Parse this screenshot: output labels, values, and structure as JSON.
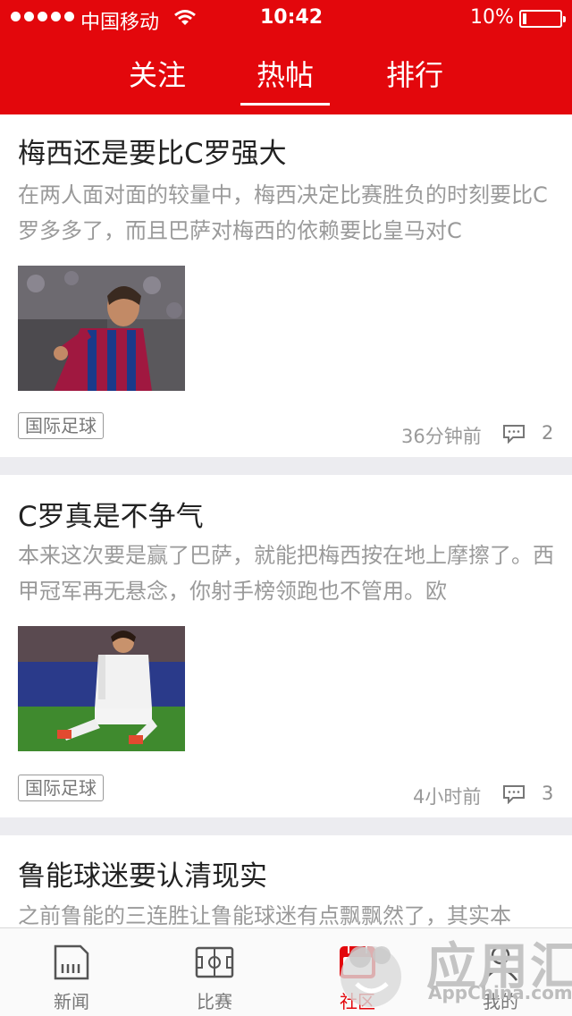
{
  "status_bar": {
    "carrier": "中国移动",
    "time": "10:42",
    "battery": "10%"
  },
  "tabs": [
    {
      "label": "关注",
      "active": false
    },
    {
      "label": "热帖",
      "active": true
    },
    {
      "label": "排行",
      "active": false
    }
  ],
  "posts": [
    {
      "title": "梅西还是要比C罗强大",
      "summary": "在两人面对面的较量中，梅西决定比赛胜负的时刻要比C罗多多了，而且巴萨对梅西的依赖要比皇马对C",
      "tag": "国际足球",
      "time": "36分钟前",
      "comments": "2"
    },
    {
      "title": "C罗真是不争气",
      "summary": "本来这次要是赢了巴萨，就能把梅西按在地上摩擦了。西甲冠军再无悬念，你射手榜领跑也不管用。欧",
      "tag": "国际足球",
      "time": "4小时前",
      "comments": "3"
    },
    {
      "title": "鲁能球迷要认清现实",
      "summary": "之前鲁能的三连胜让鲁能球迷有点飘飘然了，其实本"
    }
  ],
  "bottom_nav": [
    {
      "label": "新闻",
      "icon": "news-icon",
      "active": false
    },
    {
      "label": "比赛",
      "icon": "pitch-icon",
      "active": false
    },
    {
      "label": "社区",
      "icon": "community-icon",
      "active": true
    },
    {
      "label": "我的",
      "icon": "profile-icon",
      "active": false
    }
  ],
  "watermark": {
    "text": "应用汇",
    "subtext": "AppChina.com"
  },
  "colors": {
    "brand": "#e3070c",
    "text": "#222222",
    "muted": "#9a9a9a",
    "background": "#ececf0"
  }
}
